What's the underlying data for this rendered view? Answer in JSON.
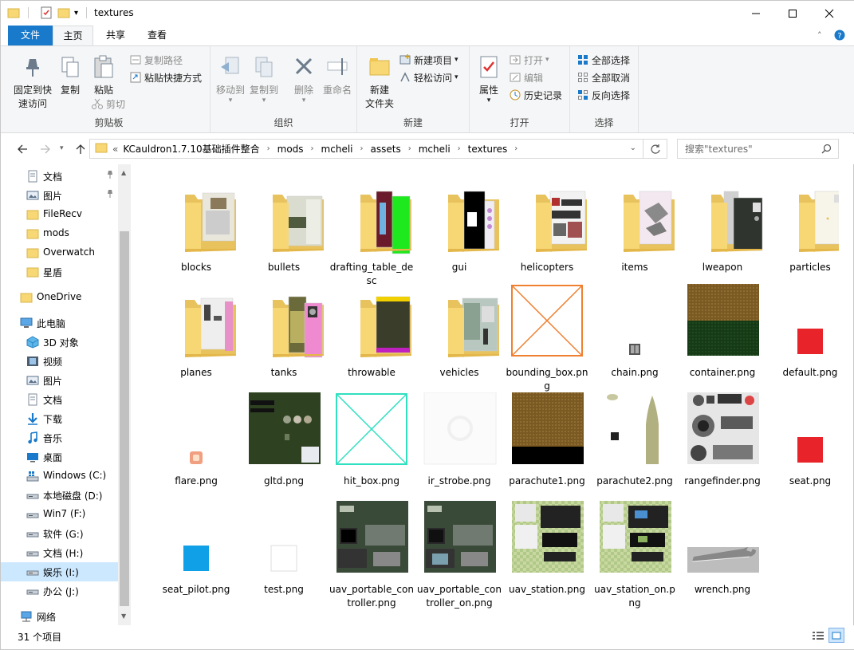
{
  "window": {
    "title": "textures"
  },
  "tabs": {
    "file": "文件",
    "home": "主页",
    "share": "共享",
    "view": "查看"
  },
  "ribbon": {
    "clipboard": {
      "label": "剪贴板",
      "pin": "固定到快速访问",
      "pin_l1": "固定到快",
      "pin_l2": "速访问",
      "copy": "复制",
      "paste": "粘贴",
      "copy_path": "复制路径",
      "paste_shortcut": "粘贴快捷方式",
      "cut": "剪切"
    },
    "organize": {
      "label": "组织",
      "move_to": "移动到",
      "copy_to": "复制到",
      "delete": "删除",
      "rename": "重命名"
    },
    "new": {
      "label": "新建",
      "new_folder_l1": "新建",
      "new_folder_l2": "文件夹",
      "new_item": "新建项目",
      "easy_access": "轻松访问"
    },
    "open": {
      "label": "打开",
      "properties": "属性",
      "open": "打开",
      "edit": "编辑",
      "history": "历史记录"
    },
    "select": {
      "label": "选择",
      "select_all": "全部选择",
      "select_none": "全部取消",
      "invert": "反向选择"
    }
  },
  "address": {
    "crumbs": [
      "KCauldron1.7.10基础插件整合",
      "mods",
      "mcheli",
      "assets",
      "mcheli",
      "textures"
    ],
    "overflow": "«",
    "search_placeholder": "搜索\"textures\""
  },
  "nav": {
    "items": [
      {
        "label": "文档",
        "icon": "document-icon",
        "pinned": true
      },
      {
        "label": "图片",
        "icon": "pictures-icon",
        "pinned": true
      },
      {
        "label": "FileRecv",
        "icon": "folder-icon"
      },
      {
        "label": "mods",
        "icon": "folder-icon"
      },
      {
        "label": "Overwatch",
        "icon": "folder-icon"
      },
      {
        "label": "星盾",
        "icon": "folder-icon"
      },
      {
        "label": "OneDrive",
        "icon": "onedrive-icon"
      },
      {
        "label": "此电脑",
        "icon": "computer-icon"
      },
      {
        "label": "3D 对象",
        "icon": "3d-objects-icon"
      },
      {
        "label": "视频",
        "icon": "videos-icon"
      },
      {
        "label": "图片",
        "icon": "pictures-icon"
      },
      {
        "label": "文档",
        "icon": "document-icon"
      },
      {
        "label": "下载",
        "icon": "download-icon"
      },
      {
        "label": "音乐",
        "icon": "music-icon"
      },
      {
        "label": "桌面",
        "icon": "desktop-icon"
      },
      {
        "label": "Windows (C:)",
        "icon": "windows-drive-icon"
      },
      {
        "label": "本地磁盘 (D:)",
        "icon": "drive-icon"
      },
      {
        "label": "Win7 (F:)",
        "icon": "drive-icon"
      },
      {
        "label": "软件 (G:)",
        "icon": "drive-icon"
      },
      {
        "label": "文档 (H:)",
        "icon": "drive-icon"
      },
      {
        "label": "娱乐 (I:)",
        "icon": "drive-icon",
        "selected": true
      },
      {
        "label": "办公 (J:)",
        "icon": "drive-icon"
      },
      {
        "label": "网络",
        "icon": "network-icon"
      }
    ]
  },
  "files": [
    {
      "name": "blocks",
      "kind": "folder"
    },
    {
      "name": "bullets",
      "kind": "folder"
    },
    {
      "name": "drafting_table_desc",
      "kind": "folder"
    },
    {
      "name": "gui",
      "kind": "folder"
    },
    {
      "name": "helicopters",
      "kind": "folder"
    },
    {
      "name": "items",
      "kind": "folder"
    },
    {
      "name": "lweapon",
      "kind": "folder"
    },
    {
      "name": "particles",
      "kind": "folder"
    },
    {
      "name": "planes",
      "kind": "folder"
    },
    {
      "name": "tanks",
      "kind": "folder"
    },
    {
      "name": "throwable",
      "kind": "folder"
    },
    {
      "name": "vehicles",
      "kind": "folder"
    },
    {
      "name": "bounding_box.png",
      "kind": "image"
    },
    {
      "name": "chain.png",
      "kind": "image"
    },
    {
      "name": "container.png",
      "kind": "image"
    },
    {
      "name": "default.png",
      "kind": "image"
    },
    {
      "name": "flare.png",
      "kind": "image"
    },
    {
      "name": "gltd.png",
      "kind": "image"
    },
    {
      "name": "hit_box.png",
      "kind": "image"
    },
    {
      "name": "ir_strobe.png",
      "kind": "image"
    },
    {
      "name": "parachute1.png",
      "kind": "image"
    },
    {
      "name": "parachute2.png",
      "kind": "image"
    },
    {
      "name": "rangefinder.png",
      "kind": "image"
    },
    {
      "name": "seat.png",
      "kind": "image"
    },
    {
      "name": "seat_pilot.png",
      "kind": "image"
    },
    {
      "name": "test.png",
      "kind": "image"
    },
    {
      "name": "uav_portable_controller.png",
      "kind": "image"
    },
    {
      "name": "uav_portable_controller_on.png",
      "kind": "image"
    },
    {
      "name": "uav_station.png",
      "kind": "image"
    },
    {
      "name": "uav_station_on.png",
      "kind": "image"
    },
    {
      "name": "wrench.png",
      "kind": "image"
    }
  ],
  "status": {
    "count": "31 个项目"
  },
  "colors": {
    "accent": "#1979ca",
    "folder": "#f8d775",
    "selected": "#cce8ff"
  }
}
